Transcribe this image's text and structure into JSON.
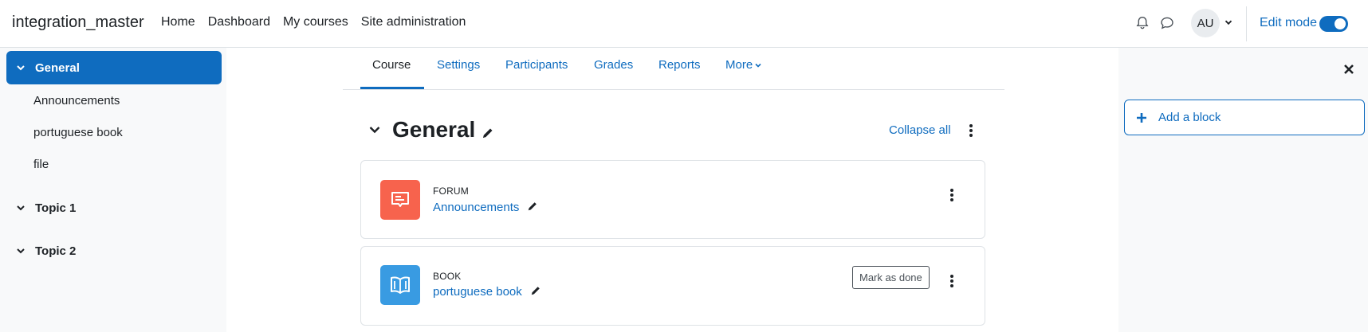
{
  "site": {
    "name": "integration_master"
  },
  "primary_nav": [
    "Home",
    "Dashboard",
    "My courses",
    "Site administration"
  ],
  "user": {
    "initials": "AU"
  },
  "edit_mode": {
    "label": "Edit mode",
    "on": true
  },
  "course_index": {
    "sections": [
      {
        "title": "General",
        "active": true,
        "items": [
          "Announcements",
          "portuguese book",
          "file"
        ]
      },
      {
        "title": "Topic 1",
        "active": false,
        "items": []
      },
      {
        "title": "Topic 2",
        "active": false,
        "items": []
      }
    ]
  },
  "tabs": [
    "Course",
    "Settings",
    "Participants",
    "Grades",
    "Reports",
    "More"
  ],
  "active_tab": "Course",
  "section": {
    "title": "General",
    "collapse_all": "Collapse all"
  },
  "activities": [
    {
      "type": "FORUM",
      "name": "Announcements",
      "icon": "forum-icon",
      "color": "#f7634d"
    },
    {
      "type": "BOOK",
      "name": "portuguese book",
      "icon": "book-icon",
      "color": "#399be2",
      "completion": "Mark as done"
    }
  ],
  "blocks": {
    "add_label": "Add a block"
  },
  "colors": {
    "brand": "#0f6cbf",
    "forum": "#f7634d",
    "book": "#399be2"
  }
}
